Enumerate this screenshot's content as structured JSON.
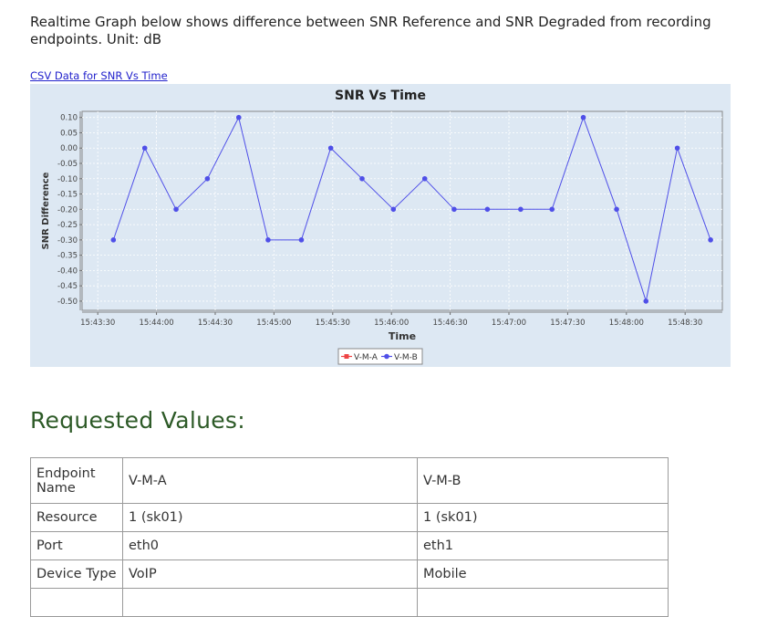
{
  "intro_text": "Realtime Graph below shows difference between SNR Reference and SNR Degraded from recording endpoints. Unit: dB",
  "csv_link_label": "CSV Data for SNR Vs Time",
  "chart_data": {
    "type": "line",
    "title": "SNR Vs Time",
    "xlabel": "Time",
    "ylabel": "SNR Difference",
    "x_ticks": [
      "15:43:30",
      "15:44:00",
      "15:44:30",
      "15:45:00",
      "15:45:30",
      "15:46:00",
      "15:46:30",
      "15:47:00",
      "15:47:30",
      "15:48:00",
      "15:48:30"
    ],
    "xlim": [
      "15:43:22",
      "15:48:49"
    ],
    "ylim": [
      -0.53,
      0.12
    ],
    "y_ticks": [
      0.1,
      0.05,
      0.0,
      -0.05,
      -0.1,
      -0.15,
      -0.2,
      -0.25,
      -0.3,
      -0.35,
      -0.4,
      -0.45,
      -0.5
    ],
    "grid": true,
    "legend_position": "bottom-center",
    "colors": {
      "background": "#dde8f3",
      "V-M-A": "#ee4444",
      "V-M-B": "#4f4fe8"
    },
    "series": [
      {
        "name": "V-M-A",
        "x": [],
        "y": []
      },
      {
        "name": "V-M-B",
        "x": [
          "15:43:38",
          "15:43:54",
          "15:44:10",
          "15:44:26",
          "15:44:42",
          "15:44:57",
          "15:45:14",
          "15:45:29",
          "15:45:45",
          "15:46:01",
          "15:46:17",
          "15:46:32",
          "15:46:49",
          "15:47:06",
          "15:47:22",
          "15:47:38",
          "15:47:55",
          "15:48:10",
          "15:48:26",
          "15:48:43"
        ],
        "y": [
          -0.3,
          0.0,
          -0.2,
          -0.1,
          0.1,
          -0.3,
          -0.3,
          0.0,
          -0.1,
          -0.2,
          -0.1,
          -0.2,
          -0.2,
          -0.2,
          -0.2,
          0.1,
          -0.2,
          -0.5,
          0.0,
          -0.3
        ]
      }
    ]
  },
  "section_title": "Requested Values:",
  "table": {
    "rows": [
      [
        "Endpoint Name",
        "V-M-A",
        "V-M-B"
      ],
      [
        "Resource",
        "1 (sk01)",
        "1 (sk01)"
      ],
      [
        "Port",
        "eth0",
        "eth1"
      ],
      [
        "Device Type",
        "VoIP",
        "Mobile"
      ],
      [
        "",
        "",
        ""
      ]
    ]
  }
}
